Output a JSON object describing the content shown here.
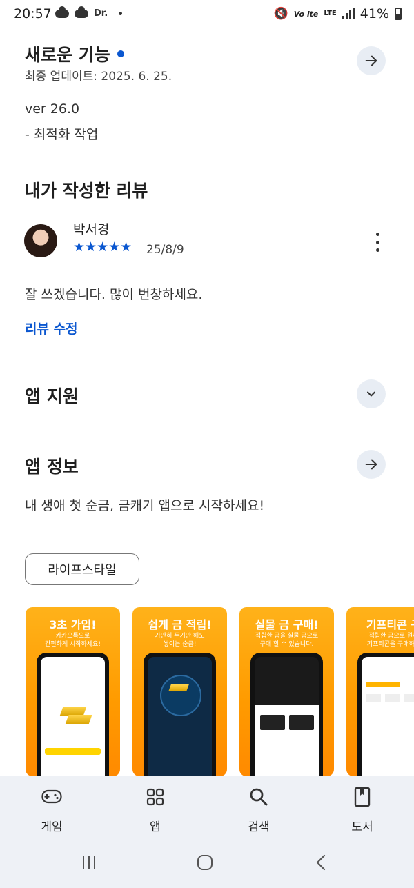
{
  "status_bar": {
    "time": "20:57",
    "left_text": "Dr.",
    "volte": "Vo lte",
    "lte": "LTE",
    "battery": "41%"
  },
  "whats_new": {
    "title": "새로운 기능",
    "updated": "최종 업데이트: 2025. 6. 25.",
    "version": "ver 26.0",
    "note": "- 최적화 작업"
  },
  "my_review": {
    "title": "내가 작성한 리뷰",
    "reviewer": "박서경",
    "stars": "★★★★★",
    "rating": 5,
    "date": "25/8/9",
    "text": "잘 쓰겠습니다. 많이 번창하세요.",
    "edit_label": "리뷰 수정"
  },
  "app_support": {
    "title": "앱 지원"
  },
  "app_info": {
    "title": "앱 정보",
    "description": "내 생애 첫 순금, 금캐기 앱으로 시작하세요!",
    "category_chip": "라이프스타일"
  },
  "screenshots": [
    {
      "title": "3초 가입!",
      "desc": "카카오톡으로\n간편하게 시작하세요!"
    },
    {
      "title": "쉽게 금 적립!",
      "desc": "가만히 두기만 해도\n쌓이는 순금!"
    },
    {
      "title": "실물 금 구매!",
      "desc": "적립한 금을 실물 금으로\n구매 할 수 있습니다."
    },
    {
      "title": "기프티콘 구",
      "desc": "적립한 금으로 원하\n기프티콘을 구매하세"
    }
  ],
  "bottom_nav": {
    "items": [
      {
        "label": "게임",
        "icon": "gamepad-icon"
      },
      {
        "label": "앱",
        "icon": "apps-grid-icon"
      },
      {
        "label": "검색",
        "icon": "search-icon"
      },
      {
        "label": "도서",
        "icon": "book-icon"
      }
    ]
  },
  "colors": {
    "accent": "#0b57d0",
    "nav_bg": "#eef1f6",
    "screenshot_orange": "#ff9b00"
  }
}
